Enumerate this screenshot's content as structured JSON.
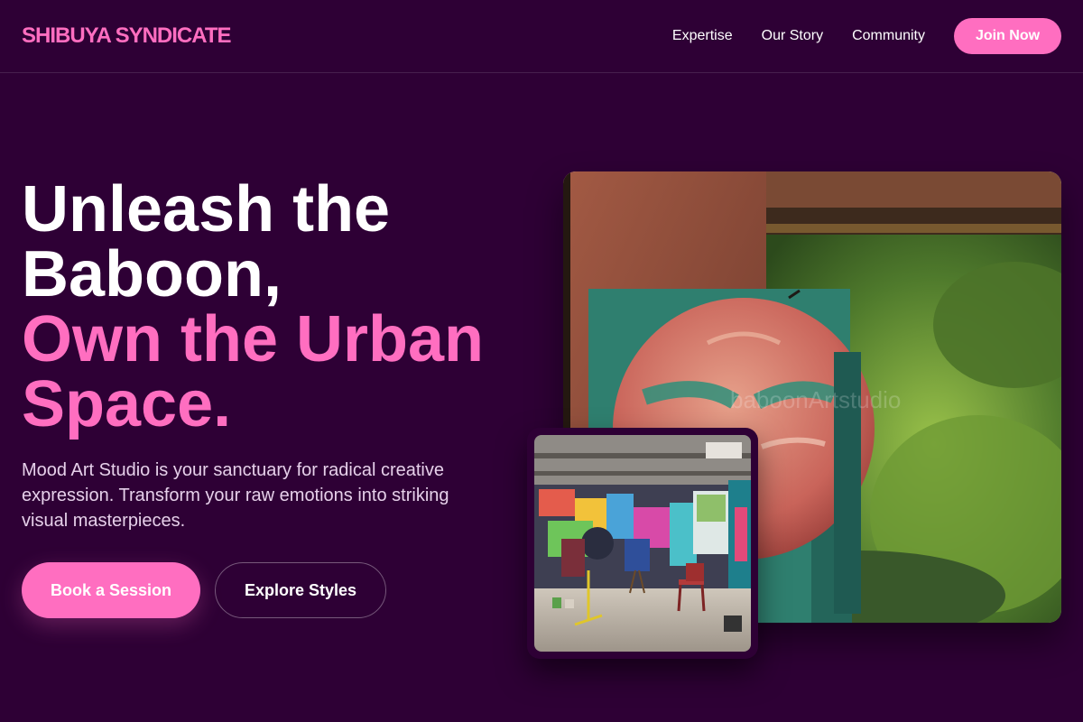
{
  "nav": {
    "logo": "SHIBUYA SYNDICATE",
    "links": [
      "Expertise",
      "Our Story",
      "Community"
    ],
    "cta": "Join Now"
  },
  "hero": {
    "title_line1": "Unleash the",
    "title_line2": "Baboon,",
    "title_accent1": "Own the Urban",
    "title_accent2": "Space.",
    "description": "Mood Art Studio is your sanctuary for radical creative expression. Transform your raw emotions into striking visual masterpieces.",
    "primary_button": "Book a Session",
    "secondary_button": "Explore Styles"
  },
  "colors": {
    "background": "#2e0035",
    "accent": "#ff6ec0",
    "text": "#ffffff",
    "muted_text": "#e6d0ea"
  },
  "images": {
    "main": "mural-circle-photo",
    "secondary": "graffiti-studio-photo"
  }
}
